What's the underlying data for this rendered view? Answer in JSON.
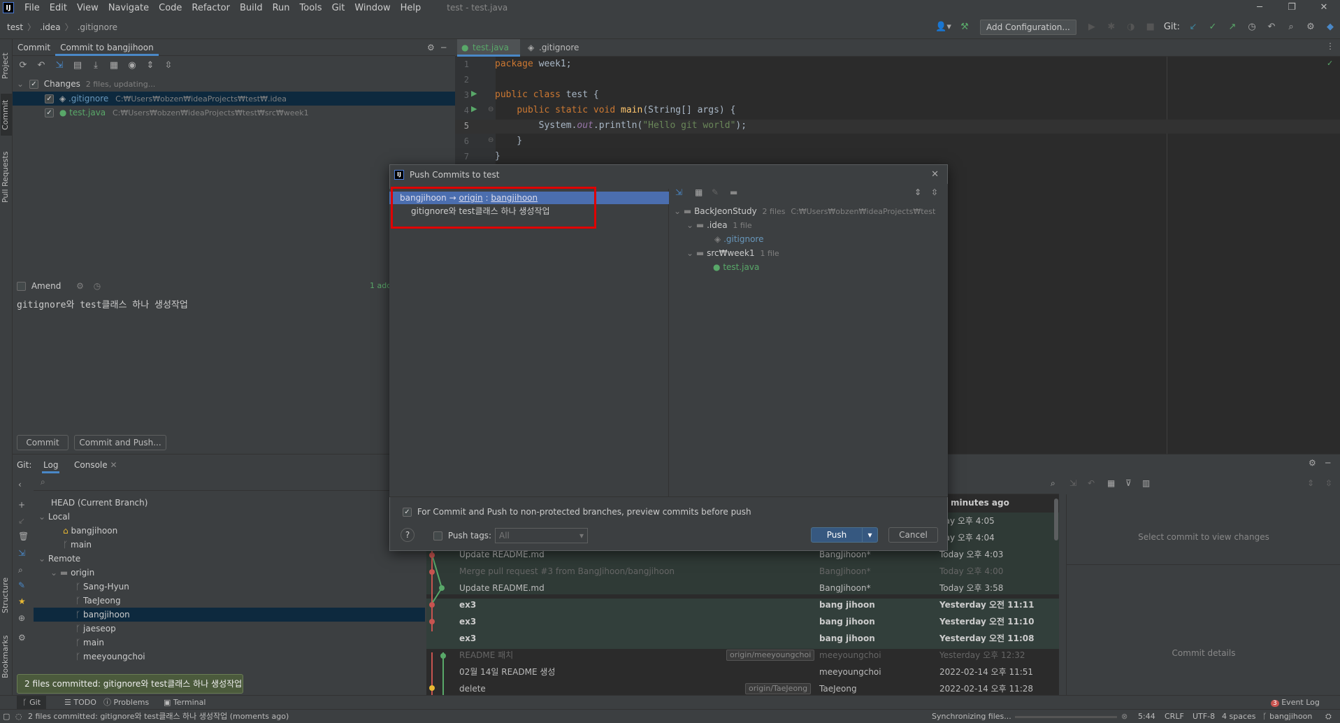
{
  "app": {
    "title": "test - test.java",
    "menu": [
      "File",
      "Edit",
      "View",
      "Navigate",
      "Code",
      "Refactor",
      "Build",
      "Run",
      "Tools",
      "Git",
      "Window",
      "Help"
    ]
  },
  "breadcrumb": [
    "test",
    ".idea",
    ".gitignore"
  ],
  "toolbar": {
    "add_config": "Add Configuration...",
    "git_label": "Git:"
  },
  "left_stripe": [
    "Project",
    "Commit",
    "Pull Requests",
    "Structure",
    "Bookmarks"
  ],
  "commit_panel": {
    "tabs": [
      "Commit",
      "Commit to bangjihoon"
    ],
    "changes_label": "Changes",
    "changes_info": "2 files, updating...",
    "files": [
      {
        "name": ".gitignore",
        "path": "C:₩Users₩obzen₩ideaProjects₩test₩.idea"
      },
      {
        "name": "test.java",
        "path": "C:₩Users₩obzen₩ideaProjects₩test₩src₩week1"
      }
    ],
    "amend_label": "Amend",
    "added_count": "1 add",
    "message": "gitignore와 test클래스 하나 생성작업",
    "commit_btn": "Commit",
    "commit_push_btn": "Commit and Push..."
  },
  "editor": {
    "tabs": [
      "test.java",
      ".gitignore"
    ],
    "lines": [
      {
        "n": "1",
        "t": "package week1;"
      },
      {
        "n": "2",
        "t": ""
      },
      {
        "n": "3",
        "t": "public class test {"
      },
      {
        "n": "4",
        "t": "    public static void main(String[] args) {"
      },
      {
        "n": "5",
        "t": "        System.out.println(\"Hello git world\");"
      },
      {
        "n": "6",
        "t": "    }"
      },
      {
        "n": "7",
        "t": "}"
      }
    ]
  },
  "dialog": {
    "title": "Push Commits to test",
    "branch_local": "bangjihoon",
    "branch_arrow": "→",
    "branch_remote": "origin",
    "branch_colon": ":",
    "branch_target": "bangjihoon",
    "commit_msg": "gitignore와 test클래스 하나 생성작업",
    "tree": {
      "root": "BackJeonStudy",
      "root_info": "2 files",
      "root_path": "C:₩Users₩obzen₩ideaProjects₩test",
      "dir1": ".idea",
      "dir1_info": "1 file",
      "file1": ".gitignore",
      "dir2": "src₩week1",
      "dir2_info": "1 file",
      "file2": "test.java"
    },
    "preview_label": "For Commit and Push to non-protected branches, preview commits before push",
    "push_tags_label": "Push tags:",
    "push_tags_value": "All",
    "push_btn": "Push",
    "cancel_btn": "Cancel",
    "help": "?"
  },
  "git_panel": {
    "tabs": [
      "Git:",
      "Log",
      "Console"
    ],
    "branches": {
      "head": "HEAD (Current Branch)",
      "local_label": "Local",
      "local": [
        "bangjihoon",
        "main"
      ],
      "remote_label": "Remote",
      "origin": "origin",
      "remote": [
        "Sang-Hyun",
        "TaeJeong",
        "bangjihoon",
        "jaeseop",
        "main",
        "meeyoungchoi"
      ]
    },
    "log_header": "minutes ago",
    "log": [
      {
        "msg": "",
        "author": "",
        "date": "day 오후 4:05",
        "style": "normal"
      },
      {
        "msg": "",
        "author": "",
        "date": "day 오후 4:04",
        "style": "normal"
      },
      {
        "msg": "Update README.md",
        "author": "BangJihoon*",
        "date": "Today 오후 4:03",
        "style": "normal"
      },
      {
        "msg": "Merge pull request #3 from BangJihoon/bangjihoon",
        "author": "BangJihoon*",
        "date": "Today 오후 4:00",
        "style": "dim"
      },
      {
        "msg": "Update README.md",
        "author": "BangJihoon*",
        "date": "Today 오후 3:58",
        "style": "normal"
      },
      {
        "msg": "ex3",
        "author": "bang jihoon",
        "date": "Yesterday 오전 11:11",
        "style": "bold"
      },
      {
        "msg": "ex3",
        "author": "bang jihoon",
        "date": "Yesterday 오전 11:10",
        "style": "bold"
      },
      {
        "msg": "ex3",
        "author": "bang jihoon",
        "date": "Yesterday 오전 11:08",
        "style": "bold"
      },
      {
        "msg": "README 패치",
        "author": "meeyoungchoi",
        "date": "Yesterday 오후 12:32",
        "style": "dim",
        "tag": "origin/meeyoungchoi"
      },
      {
        "msg": "02월 14일 README 생성",
        "author": "meeyoungchoi",
        "date": "2022-02-14 오후 11:51",
        "style": "normal"
      },
      {
        "msg": "delete",
        "author": "TaeJeong",
        "date": "2022-02-14 오후 11:28",
        "style": "normal",
        "tag": "origin/TaeJeong"
      }
    ],
    "select_commit": "Select commit to view changes",
    "commit_details": "Commit details"
  },
  "tooltip": "2 files committed: gitignore와 test클래스 하나 생성작업",
  "bottom_tabs": [
    "Git",
    "TODO",
    "Problems",
    "Terminal"
  ],
  "event_log": "Event Log",
  "event_count": "3",
  "status": {
    "message": "2 files committed: gitignore와 test클래스 하나 생성작업 (moments ago)",
    "sync": "Synchronizing files...",
    "pos": "5:44",
    "eol": "CRLF",
    "enc": "UTF-8",
    "indent": "4 spaces",
    "branch": "bangjihoon"
  }
}
